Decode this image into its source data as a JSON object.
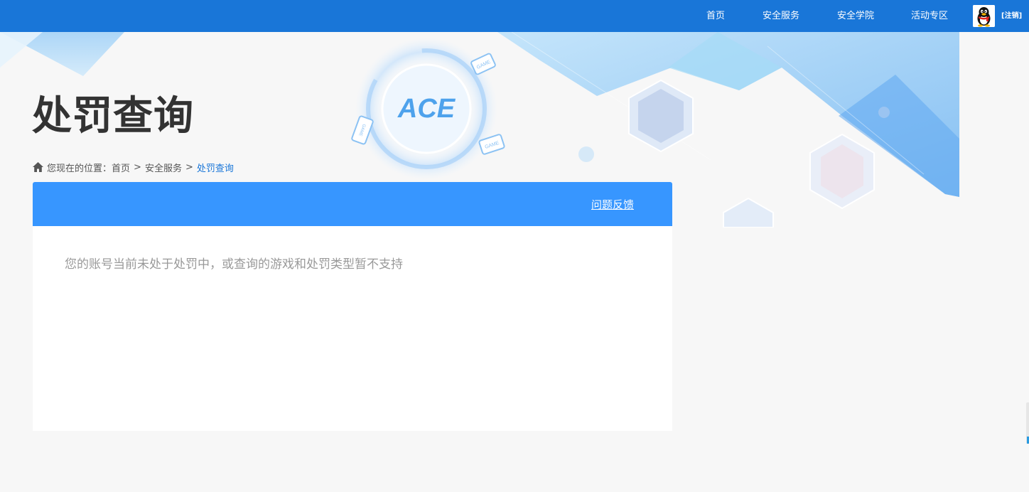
{
  "nav": {
    "items": [
      {
        "label": "首页"
      },
      {
        "label": "安全服务"
      },
      {
        "label": "安全学院"
      },
      {
        "label": "活动专区"
      }
    ],
    "logout_label": "[注销]"
  },
  "banner": {
    "logo_text": "ACE",
    "badge_text": "GAME"
  },
  "page": {
    "title": "处罚查询"
  },
  "breadcrumb": {
    "prefix": "您现在的位置：",
    "items": [
      {
        "label": "首页"
      },
      {
        "label": "安全服务"
      }
    ],
    "separator": ">",
    "current": "处罚查询"
  },
  "panel": {
    "feedback_label": "问题反馈",
    "status_message": "您的账号当前未处于处罚中，或查询的游戏和处罚类型暂不支持"
  },
  "colors": {
    "nav_bg": "#1976d8",
    "panel_header": "#3796ff",
    "title": "#333333",
    "message": "#999999"
  }
}
